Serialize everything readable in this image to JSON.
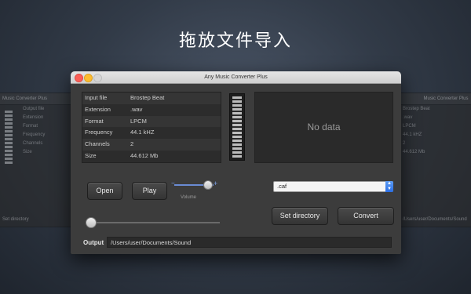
{
  "headline": "拖放文件导入",
  "window": {
    "title": "Any Music Converter Plus"
  },
  "info_rows": [
    {
      "key": "Input file",
      "value": "Brostep Beat"
    },
    {
      "key": "Extension",
      "value": ".wav"
    },
    {
      "key": "Format",
      "value": "LPCM"
    },
    {
      "key": "Frequency",
      "value": "44.1 kHZ"
    },
    {
      "key": "Channels",
      "value": "2"
    },
    {
      "key": "Size",
      "value": "44.612 Mb"
    }
  ],
  "waveform": {
    "placeholder": "No data"
  },
  "controls": {
    "open_label": "Open",
    "play_label": "Play",
    "volume_label": "Volume",
    "volume_minus": "−",
    "volume_plus": "+",
    "volume_level": 0.85,
    "seek_position": 0.0,
    "format_select": ".caf",
    "set_directory_label": "Set directory",
    "convert_label": "Convert"
  },
  "output": {
    "label": "Output",
    "path": "/Users/user/Documents/Sound"
  },
  "ghost_left": {
    "title": "Music Converter Plus",
    "rows": [
      "Output file",
      "Extension",
      "Format",
      "Frequency",
      "Channels",
      "Size"
    ],
    "footer": "Set directory"
  },
  "ghost_right": {
    "title": "Music Converter Plus",
    "rows": [
      "Brostep Beat",
      ".wav",
      "LPCM",
      "44.1 kHZ",
      "2",
      "44.612 Mb"
    ],
    "footer": "/Users/user/Documents/Sound"
  },
  "colors": {
    "accent": "#2a6de3",
    "close": "#fc5f57",
    "minimize": "#fdbc2e"
  }
}
